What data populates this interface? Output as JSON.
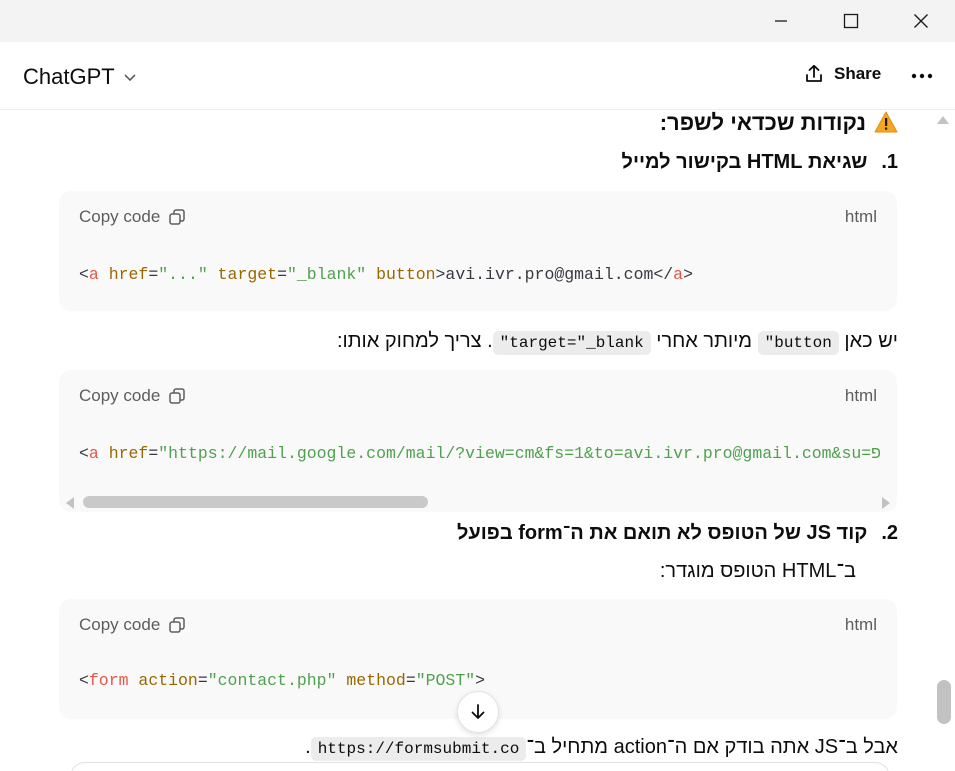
{
  "header": {
    "app_title": "ChatGPT",
    "share_label": "Share"
  },
  "content": {
    "heading": "נקודות שכדאי לשפר:",
    "item1": {
      "number": "1.",
      "title": "שגיאת HTML בקישור למייל"
    },
    "code1": {
      "copy_label": "Copy code",
      "lang": "html"
    },
    "para1": {
      "part_a": "יש כאן ",
      "code_button": "\"button",
      "part_b": " מיותר אחרי ",
      "code_target": "\"target=\"_blank",
      "part_c": ". צריך למחוק אותו:"
    },
    "code2": {
      "copy_label": "Copy code",
      "lang": "html"
    },
    "item2": {
      "number": "2.",
      "title": "קוד JS של הטופס לא תואם את ה־form בפועל"
    },
    "para2": "ב־HTML הטופס מוגדר:",
    "code3": {
      "copy_label": "Copy code",
      "lang": "html"
    },
    "para3": {
      "part_a": "אבל ב־JS אתה בודק אם ה־action מתחיל ב־",
      "code_url": "https://formsubmit.co",
      "part_b": "."
    }
  },
  "code_lines": {
    "line1": {
      "open": "<",
      "tag": "a",
      "attr1": "href",
      "eq1": "=",
      "val1": "\"...\"",
      "attr2": "target",
      "eq2": "=",
      "val2": "\"_blank\"",
      "attr3": "button",
      "text": ">avi.ivr.pro@gmail.com</",
      "close_tag": "a",
      "close": ">"
    },
    "line2": {
      "open": "<",
      "tag": "a",
      "attr1": "href",
      "eq1": "=",
      "val1": "\"https://mail.google.com/mail/?view=cm&fs=1&to=avi.ivr.pro@gmail.com&su=פ"
    },
    "line3": {
      "open": "<",
      "tag": "form",
      "attr1": "action",
      "eq1": "=",
      "val1": "\"contact.php\"",
      "attr2": "method",
      "eq2": "=",
      "val2": "\"POST\"",
      "close": ">"
    }
  },
  "colors": {
    "tag": "#e45649",
    "attr": "#986801",
    "string": "#50a14f",
    "warning": "#f5a623"
  },
  "icons": [
    "minimize-icon",
    "maximize-icon",
    "close-icon",
    "chevron-down-icon",
    "share-icon",
    "more-icon",
    "warning-icon",
    "copy-icon",
    "arrow-down-icon"
  ]
}
